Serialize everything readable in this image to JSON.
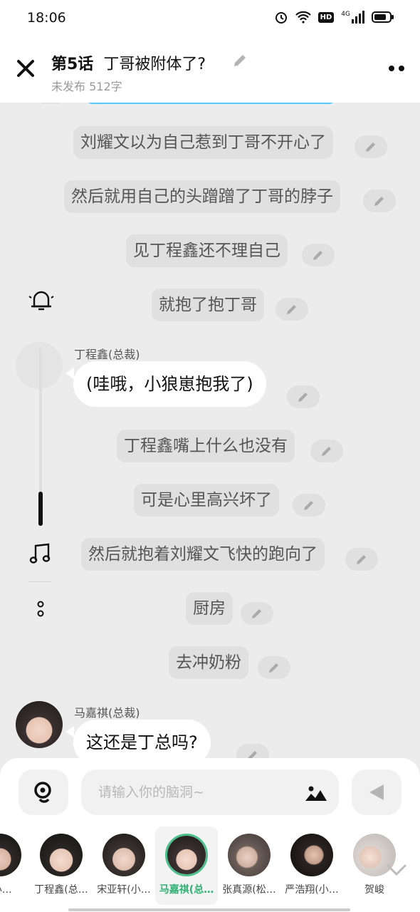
{
  "status": {
    "time": "18:06",
    "hd": "HD",
    "net": "4G"
  },
  "header": {
    "chapter": "第5话",
    "title": "丁哥被附体了?",
    "subtitle": "未发布 512字"
  },
  "messages": {
    "m1": "刘耀文以为自己惹到丁哥不开心了",
    "m2": "然后就用自己的头蹭蹭了丁哥的脖子",
    "m3": "见丁程鑫还不理自己",
    "m4": "就抱了抱丁哥",
    "speaker1": "丁程鑫(总裁)",
    "d1": "(哇哦，小狼崽抱我了)",
    "m5": "丁程鑫嘴上什么也没有",
    "m6": "可是心里高兴坏了",
    "m7": "然后就抱着刘耀文飞快的跑向了",
    "m8": "厨房",
    "m9": "去冲奶粉",
    "speaker2": "马嘉祺(总裁)",
    "d2": "这还是丁总吗?"
  },
  "input": {
    "placeholder": "请输入你的脑洞~"
  },
  "characters": [
    {
      "name": "(小…"
    },
    {
      "name": "丁程鑫(总…"
    },
    {
      "name": "宋亚轩(小…"
    },
    {
      "name": "马嘉祺(总…",
      "selected": true
    },
    {
      "name": "张真源(松…"
    },
    {
      "name": "严浩翔(小…"
    },
    {
      "name": "贺峻"
    }
  ],
  "colors": {
    "accent": "#4cc08a",
    "bubble": "#e0e0e0",
    "dialog": "#ffffff"
  }
}
